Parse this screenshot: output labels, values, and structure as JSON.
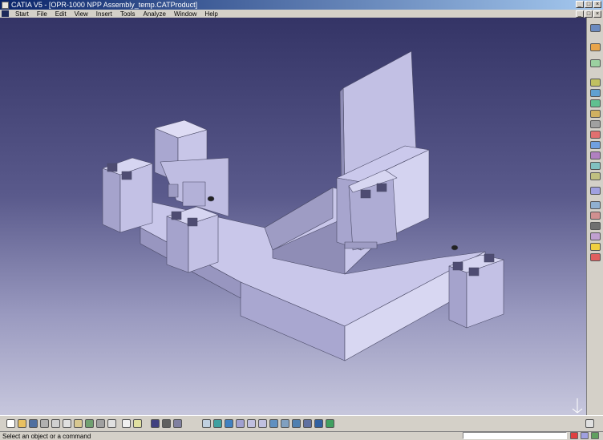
{
  "window": {
    "title": "CATIA V5 - [OPR-1000 NPP Assembly_temp.CATProduct]",
    "minimize_glyph": "_",
    "maximize_glyph": "□",
    "close_glyph": "×"
  },
  "menu": {
    "items": [
      "Start",
      "File",
      "Edit",
      "View",
      "Insert",
      "Tools",
      "Analyze",
      "Window",
      "Help"
    ]
  },
  "viewport": {
    "background_top": "#343466",
    "background_bottom": "#c7c7dd",
    "model_color": "#c4c2e6",
    "compass_label": "z"
  },
  "toolbars": {
    "right_icons": [
      "workbench-icon",
      "select-icon",
      "snap-icon",
      "product-icon",
      "component-icon",
      "part-icon",
      "existing-component-icon",
      "replace-icon",
      "graph-tree-icon",
      "generate-numbering-icon",
      "reorder-icon",
      "multi-instantiation-icon",
      "fast-instantiation-icon",
      "constraints-icon",
      "bill-of-material-icon",
      "clash-icon",
      "section-icon",
      "measure-icon",
      "lightbulb-icon",
      "scene-icon"
    ],
    "bottom_icons": [
      "new-icon",
      "open-icon",
      "save-icon",
      "print-icon",
      "cut-icon",
      "copy-icon",
      "paste-icon",
      "undo-icon",
      "redo-icon",
      "help-icon",
      "formula-icon",
      "comment-icon",
      "view-mode-icon",
      "render-icon",
      "hide-show-icon",
      "fly-icon",
      "fit-all-icon",
      "pan-icon",
      "rotate-icon",
      "zoom-in-icon",
      "zoom-out-icon",
      "normal-view-icon",
      "iso-view-icon",
      "multi-view-icon",
      "shading-icon",
      "hide-icon",
      "swap-icon",
      "sketch-icon"
    ]
  },
  "status": {
    "message": "Select an object or a command",
    "command_value": ""
  }
}
